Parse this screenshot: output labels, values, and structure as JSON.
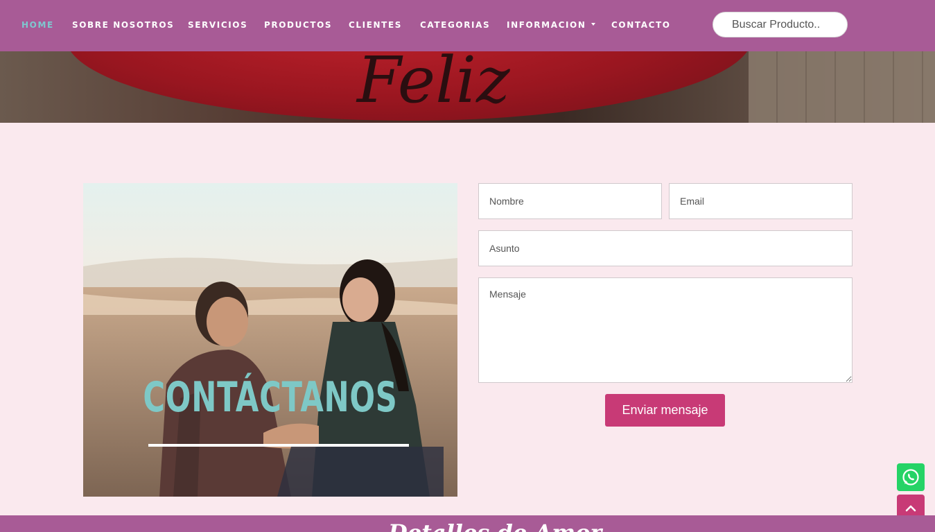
{
  "nav": {
    "items": [
      {
        "label": "HOME",
        "active": true
      },
      {
        "label": "SOBRE NOSOTROS"
      },
      {
        "label": "SERVICIOS"
      },
      {
        "label": "PRODUCTOS"
      },
      {
        "label": "CLIENTES"
      },
      {
        "label": "CATEGORIAS"
      },
      {
        "label": "INFORMACION",
        "dropdown": true
      },
      {
        "label": "CONTACTO"
      }
    ],
    "search_placeholder": "Buscar Producto.."
  },
  "hero": {
    "text": "Feliz"
  },
  "contact": {
    "image_title": "CONTÁCTANOS",
    "form": {
      "name_placeholder": "Nombre",
      "email_placeholder": "Email",
      "subject_placeholder": "Asunto",
      "message_placeholder": "Mensaje",
      "submit_label": "Enviar mensaje"
    }
  },
  "floating": {
    "whatsapp_icon": "whatsapp-icon",
    "scroll_top_icon": "chevron-up-icon"
  },
  "footer": {
    "brand_script": "Detalles de Amor"
  },
  "colors": {
    "nav_bg": "#a85b96",
    "nav_active": "#7ec8cf",
    "page_bg": "#fae9ee",
    "accent": "#c83a76",
    "whatsapp": "#25d366",
    "contact_title": "#7ec8c6"
  }
}
